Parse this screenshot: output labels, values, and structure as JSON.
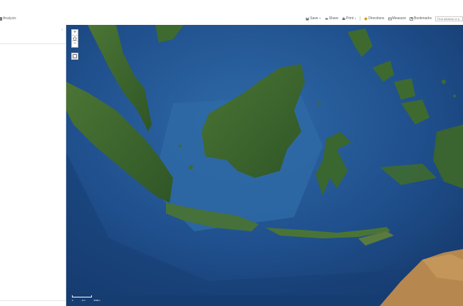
{
  "toolbar": {
    "analysis_label": "Analysis",
    "save_label": "Save",
    "share_label": "Share",
    "print_label": "Print",
    "directions_label": "Directions",
    "measure_label": "Measure",
    "bookmarks_label": "Bookmarks",
    "search_placeholder": "Find address or p"
  },
  "panel": {
    "collapse_glyph": "‹"
  },
  "map": {
    "zoom_in": "+",
    "zoom_out": "−",
    "scale_labels": [
      "0",
      "1mi",
      "300km"
    ]
  },
  "colors": {
    "ocean_deep": "#173f75",
    "ocean_shelf": "#2f6aa8",
    "land_green": "#3f6a2f",
    "land_dark": "#2e5424",
    "desert": "#b6874e"
  },
  "icons": {
    "save": "floppy-icon",
    "share": "share-icon",
    "print": "printer-icon",
    "directions": "directions-icon",
    "measure": "ruler-icon",
    "bookmarks": "bookmark-icon",
    "home": "home-icon",
    "fullscreen": "fullscreen-icon"
  }
}
